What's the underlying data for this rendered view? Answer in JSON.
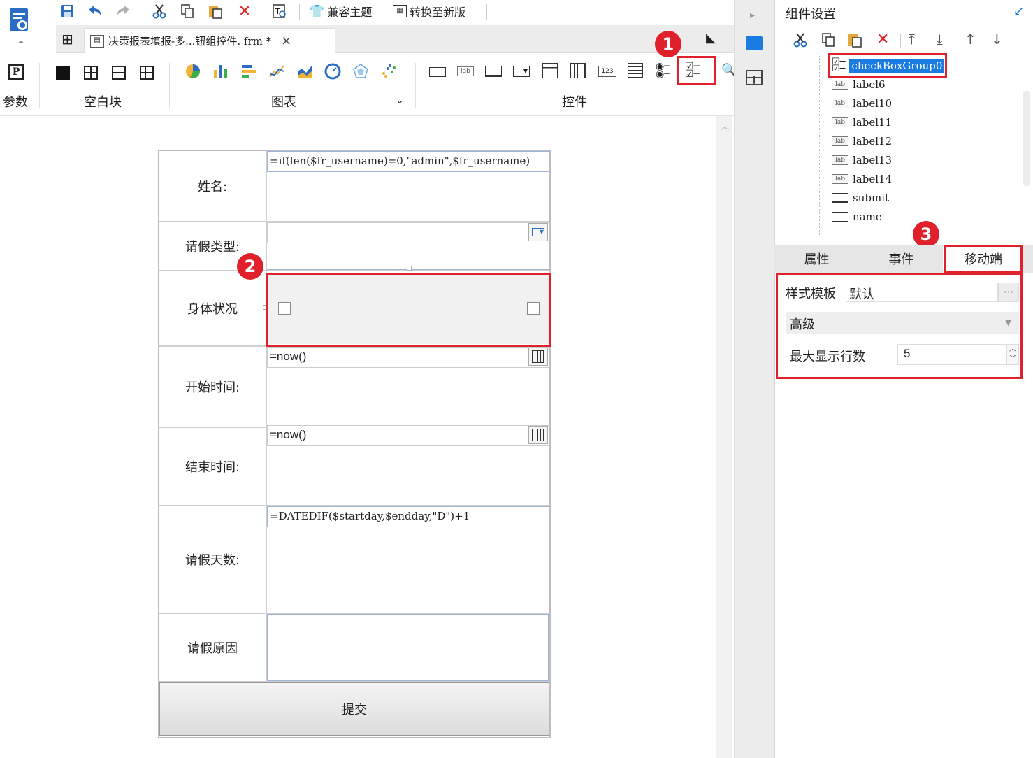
{
  "toolbar": {
    "compat_theme": "兼容主题",
    "convert_new": "转换至新版"
  },
  "tab": {
    "title": "决策报表填报-多...钮组控件. frm *",
    "close": "×"
  },
  "ribbon": {
    "groups": {
      "param": "参数",
      "blank": "空白块",
      "chart": "图表",
      "widget": "控件"
    }
  },
  "form": {
    "rows": [
      {
        "label": "姓名:",
        "value": "=if(len($fr_username)=0,\"admin\",$fr_username)"
      },
      {
        "label": "请假类型:",
        "value": ""
      },
      {
        "label": "身体状况",
        "value": ""
      },
      {
        "label": "开始时间:",
        "value": "=now()"
      },
      {
        "label": "结束时间:",
        "value": "=now()"
      },
      {
        "label": "请假天数:",
        "value": "=DATEDIF($startday,$endday,\"D\")+1"
      },
      {
        "label": "请假原因",
        "value": ""
      }
    ],
    "submit": "提交"
  },
  "panel": {
    "title": "组件设置",
    "tree": [
      "checkBoxGroup0",
      "label6",
      "label10",
      "label11",
      "label12",
      "label13",
      "label14",
      "submit",
      "name"
    ],
    "tabs": [
      "属性",
      "事件",
      "移动端"
    ],
    "style_template_label": "样式模板",
    "style_template_value": "默认",
    "more": "···",
    "advanced": "高级",
    "max_rows_label": "最大显示行数",
    "max_rows_value": "5"
  },
  "badges": [
    "1",
    "2",
    "3"
  ],
  "colors": {
    "accent_red": "#e0202a",
    "accent_blue": "#1a7be0",
    "selection": "#1a7be0"
  }
}
